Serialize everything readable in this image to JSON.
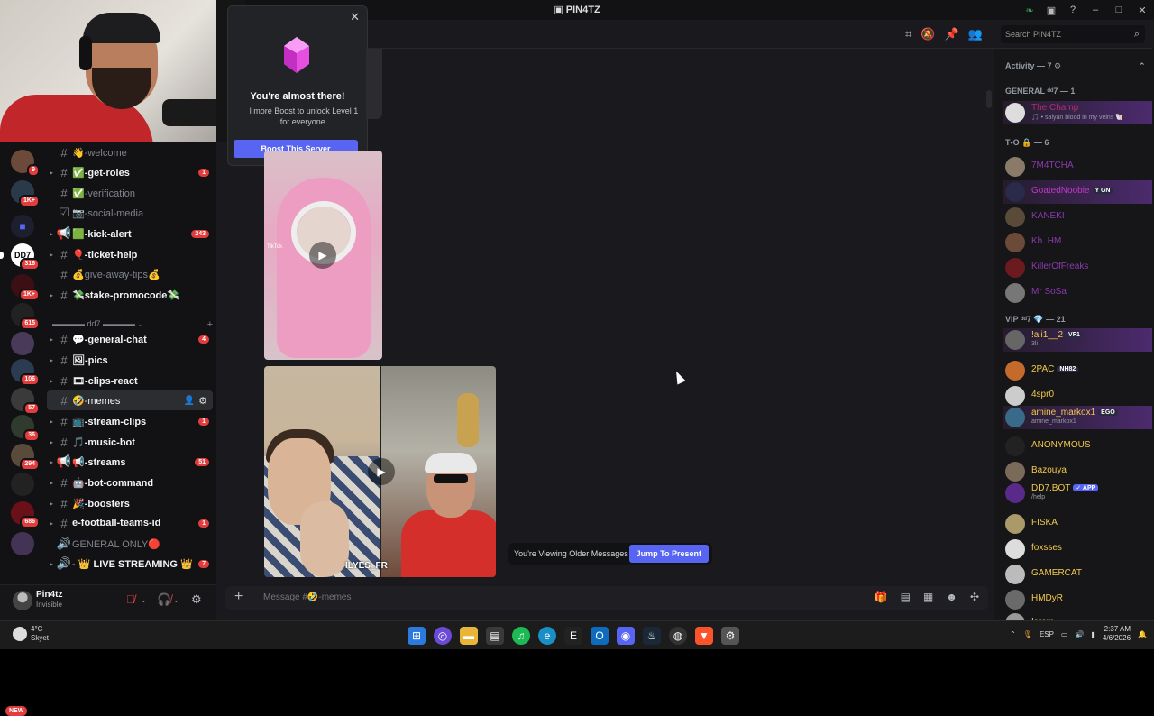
{
  "window": {
    "title": "PIN4TZ"
  },
  "boost_popup": {
    "heading": "You're almost there!",
    "body": "l more Boost to unlock Level 1 for everyone.",
    "button": "Boost This Server"
  },
  "server_badges": [
    "9",
    "1K+",
    "316",
    "1K+",
    "615",
    "106",
    "57",
    "36",
    "294",
    "686",
    "NEW"
  ],
  "channels": [
    {
      "label": "👋-welcome",
      "style": "muted"
    },
    {
      "label": "✅-get-roles",
      "style": "unread",
      "count": "1"
    },
    {
      "label": "✅-verification",
      "style": "muted"
    },
    {
      "label": "📷-social-media",
      "style": "muted"
    },
    {
      "label": "🟩-kick-alert",
      "style": "unread",
      "count": "243"
    },
    {
      "label": "🎈-ticket-help",
      "style": "unread"
    },
    {
      "label": "💰give-away-tips💰",
      "style": "muted"
    },
    {
      "label": "💸stake-promocode💸",
      "style": "unread"
    },
    {
      "label": "💬-general-chat",
      "style": "unread",
      "count": "4"
    },
    {
      "label": "🖼-pics",
      "style": "unread"
    },
    {
      "label": "🎞-clips-react",
      "style": "unread"
    },
    {
      "label": "🤣-memes",
      "style": "sel"
    },
    {
      "label": "📺-stream-clips",
      "style": "unread",
      "count": "1"
    },
    {
      "label": "🎵-music-bot",
      "style": "unread"
    },
    {
      "label": "📢-streams",
      "style": "unread",
      "count": "51"
    },
    {
      "label": "🤖-bot-command",
      "style": "unread"
    },
    {
      "label": "🎉-boosters",
      "style": "unread"
    },
    {
      "label": "e-football-teams-id",
      "style": "unread",
      "count": "1"
    },
    {
      "label": "GENERAL ONLY🔴",
      "style": "muted"
    },
    {
      "label": "- 👑 LIVE STREAMING 👑",
      "style": "unread",
      "count": "7"
    }
  ],
  "category": {
    "label": "▬▬▬▬ dd7 ▬▬▬▬ ⌄"
  },
  "user": {
    "name": "Pin4tz",
    "status": "Invisible"
  },
  "header": {
    "search_placeholder": "Search PIN4TZ"
  },
  "video1": {
    "watermark": "TikTok"
  },
  "video2": {
    "caption": "ILYES_FR"
  },
  "older_bar": {
    "text": "You're Viewing Older Messages",
    "button": "Jump To Present"
  },
  "composer": {
    "placeholder": "Message #🤣-memes"
  },
  "members": {
    "activity": "Activity — 7 ⚙",
    "groups": [
      {
        "title": "GENERAL ᵈᵈ7 — 1"
      },
      {
        "title": "T•O 🔒 — 6"
      },
      {
        "title": "VIP ᵈᵈ7 💎 — 21"
      }
    ],
    "list": [
      {
        "name": "The Champ",
        "status": "🎵 • saiyan blood in my veins 🐚",
        "color": "#b0306a",
        "hl": true
      },
      {
        "name": "7M4TCHA",
        "color": "#8a3ab0"
      },
      {
        "name": "GoatedNoobie",
        "tag": "Y GN",
        "color": "#c338c9",
        "hl": true
      },
      {
        "name": "KANEKI",
        "color": "#8a3ab0"
      },
      {
        "name": "Kh. HM",
        "color": "#8a3ab0"
      },
      {
        "name": "KillerOfFreaks",
        "color": "#8a3ab0"
      },
      {
        "name": "Mr SoSa",
        "color": "#8a3ab0"
      },
      {
        "name": "!ali1__2",
        "tag": "VF1",
        "status": "3li",
        "color": "#f2c94c",
        "hl": true
      },
      {
        "name": "2PAC",
        "tag": "NH82",
        "color": "#f2c94c"
      },
      {
        "name": "4spr0",
        "color": "#f2c94c"
      },
      {
        "name": "amine_markox1",
        "tag": "EGO",
        "status": "amine_markox1",
        "color": "#f2c94c",
        "hl": true
      },
      {
        "name": "ANONYMOUS",
        "color": "#f2c94c"
      },
      {
        "name": "Bazouya",
        "color": "#f2c94c"
      },
      {
        "name": "DD7.BOT",
        "tag": "✓ APP",
        "status": "/help",
        "color": "#f2c94c"
      },
      {
        "name": "FISKA",
        "color": "#f2c94c"
      },
      {
        "name": "foxsses",
        "color": "#f2c94c"
      },
      {
        "name": "GAMERCAT",
        "color": "#f2c94c"
      },
      {
        "name": "HMDyR",
        "color": "#f2c94c"
      },
      {
        "name": "Isram",
        "color": "#f2c94c"
      }
    ]
  },
  "taskbar": {
    "temp": "4°C",
    "weather": "Skyet",
    "lang": "ESP",
    "time": "2:37 AM",
    "date": "4/6/2026"
  },
  "colors": {
    "blurple": "#5865f2",
    "badge_red": "#e23d3d",
    "bg": "#1a1a1e"
  }
}
